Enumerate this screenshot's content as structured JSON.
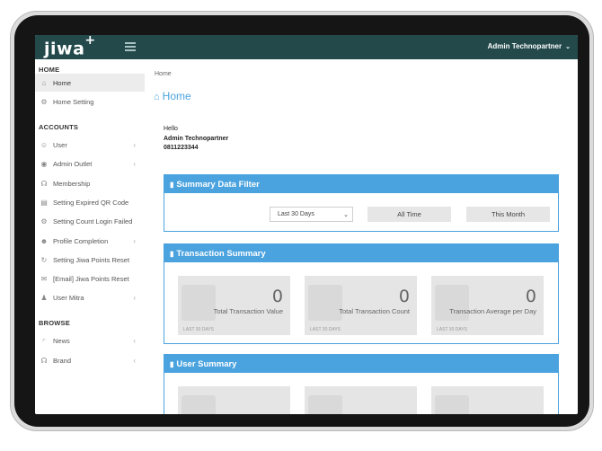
{
  "header": {
    "logo": "jiwa",
    "logo_plus": "+",
    "user_name": "Admin Technopartner"
  },
  "sidebar": {
    "sections": [
      {
        "title": "HOME"
      },
      {
        "title": "ACCOUNTS"
      },
      {
        "title": "BROWSE"
      }
    ],
    "items": [
      {
        "label": "Home",
        "icon": "home-icon",
        "active": true
      },
      {
        "label": "Home Setting",
        "icon": "gear-icon"
      },
      {
        "label": "User",
        "icon": "users-icon",
        "submenu": true
      },
      {
        "label": "Admin Outlet",
        "icon": "eye-icon",
        "submenu": true
      },
      {
        "label": "Membership",
        "icon": "headset-icon"
      },
      {
        "label": "Setting Expired QR Code",
        "icon": "document-icon"
      },
      {
        "label": "Setting Count Login Failed",
        "icon": "gear-icon"
      },
      {
        "label": "Profile Completion",
        "icon": "user-icon",
        "submenu": true
      },
      {
        "label": "Setting Jiwa Points Reset",
        "icon": "refresh-icon"
      },
      {
        "label": "[Email] Jiwa Points Reset",
        "icon": "envelope-icon"
      },
      {
        "label": "User Mitra",
        "icon": "user-tie-icon",
        "submenu": true
      },
      {
        "label": "News",
        "icon": "rss-icon",
        "submenu": true
      },
      {
        "label": "Brand",
        "icon": "headset-icon",
        "submenu": true
      }
    ]
  },
  "breadcrumb": "Home",
  "page_title": "Home",
  "greeting": {
    "hello": "Hello",
    "name": "Admin Technopartner",
    "phone": "0811223344"
  },
  "summary_filter": {
    "title": "Summary Data Filter",
    "select_value": "Last 30 Days",
    "btn_all_time": "All Time",
    "btn_this_month": "This Month"
  },
  "transaction_summary": {
    "title": "Transaction Summary",
    "cards": [
      {
        "value": "0",
        "label": "Total Transaction Value",
        "period": "LAST 30 DAYS"
      },
      {
        "value": "0",
        "label": "Total Transaction Count",
        "period": "LAST 30 DAYS"
      },
      {
        "value": "0",
        "label": "Transaction Average per Day",
        "period": "LAST 30 DAYS"
      }
    ]
  },
  "user_summary": {
    "title": "User Summary"
  },
  "colors": {
    "topbar": "#23494b",
    "accent": "#4aa3df"
  }
}
